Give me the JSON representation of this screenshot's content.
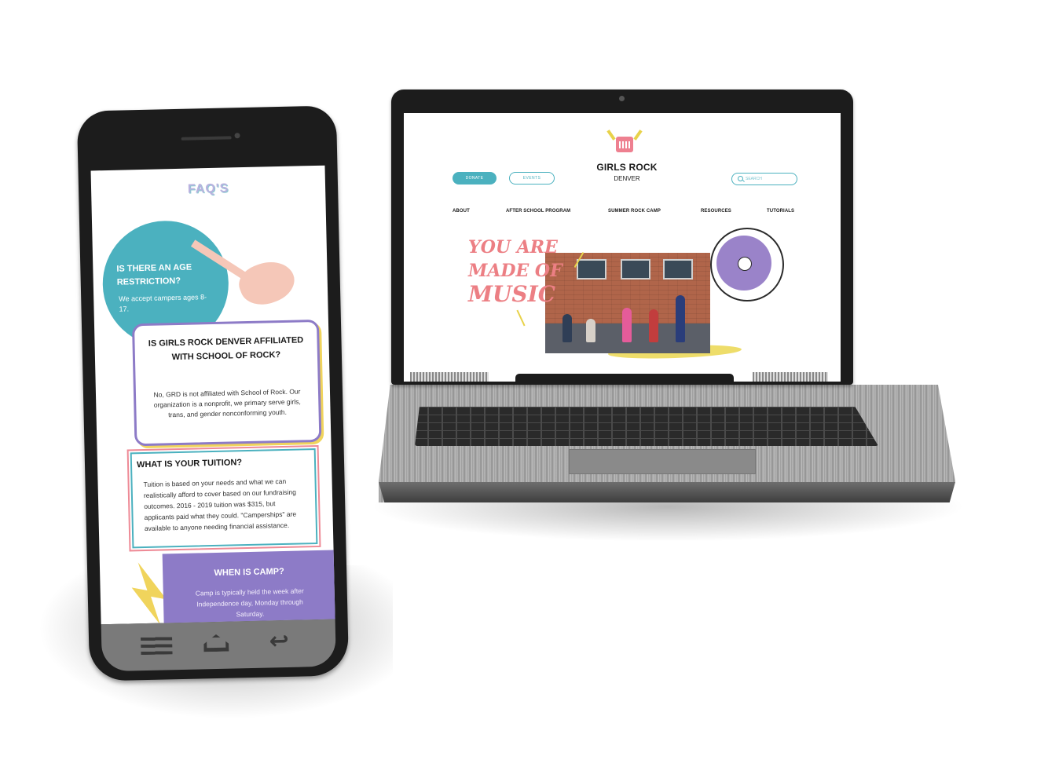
{
  "laptop_site": {
    "brand": "GIRLS ROCK",
    "brand_sub": "DENVER",
    "donate_label": "DONATE",
    "events_label": "EVENTS",
    "search_placeholder": "SEARCH",
    "nav": [
      "ABOUT",
      "AFTER SCHOOL PROGRAM",
      "SUMMER ROCK CAMP",
      "RESOURCES",
      "TUTORIALS"
    ],
    "hero": {
      "line1": "YOU ARE",
      "line2": "MADE OF",
      "line3": "MUSIC"
    },
    "colors": {
      "teal": "#4bb1bf",
      "pink": "#ec7f84",
      "purple": "#9a83c9",
      "yellow": "#ecd95a"
    },
    "icons": [
      "amp-logo-icon",
      "search-icon",
      "vinyl-record-icon"
    ]
  },
  "phone_site": {
    "title": "FAQ'S",
    "faqs": [
      {
        "question": "IS THERE AN AGE RESTRICTION?",
        "answer": "We accept campers ages 8-17."
      },
      {
        "question": "IS GIRLS ROCK DENVER AFFILIATED WITH SCHOOL OF ROCK?",
        "answer": "No, GRD is not affiliated with School of Rock. Our organization is a nonprofit, we primary serve girls, trans, and gender nonconforming youth."
      },
      {
        "question": "WHAT IS YOUR TUITION?",
        "answer": "Tuition is based on your needs and what we can realistically afford to cover based on our fundraising outcomes. 2016 - 2019 tuition was $315, but applicants paid what they could. \"Camperships\" are available to anyone needing financial assistance."
      },
      {
        "question": "WHEN IS CAMP?",
        "answer": "Camp is typically held the week after Independence day, Monday through Saturday."
      }
    ],
    "icons": [
      "guitar-icon",
      "lightning-bolt-icon",
      "menu-icon",
      "home-icon",
      "back-icon"
    ],
    "colors": {
      "teal": "#4bb1bf",
      "purple": "#8d7bc7",
      "pink": "#ee8a96",
      "yellow": "#f0d45c",
      "title_lavender": "#b9b2df"
    }
  }
}
